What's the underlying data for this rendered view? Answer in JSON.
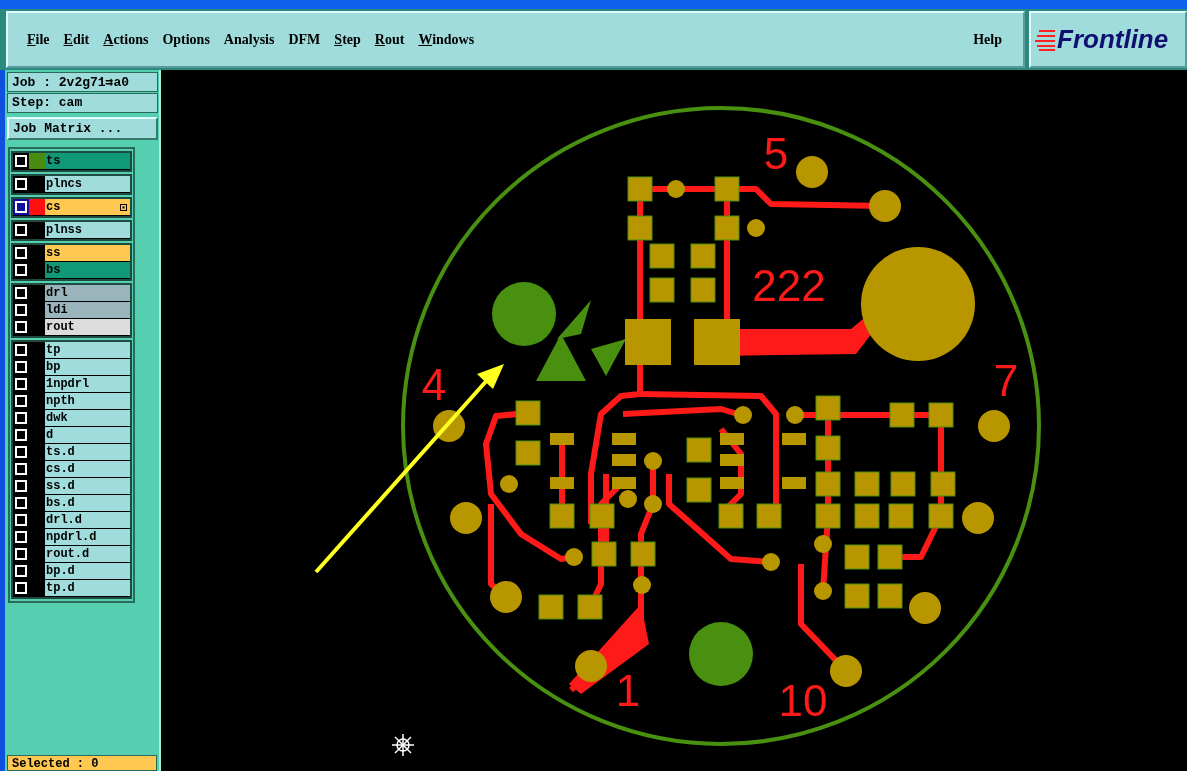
{
  "menu": [
    {
      "label": "File",
      "underlined": true
    },
    {
      "label": "Edit",
      "underlined": true
    },
    {
      "label": "Actions",
      "underlined": true
    },
    {
      "label": "Options",
      "underlined": false
    },
    {
      "label": "Analysis",
      "underlined": false
    },
    {
      "label": "DFM",
      "underlined": false
    },
    {
      "label": "Step",
      "underlined": true
    },
    {
      "label": "Rout",
      "underlined": true
    },
    {
      "label": "Windows",
      "underlined": true
    }
  ],
  "help": "Help",
  "logo": "Frontline",
  "job": "Job : 2v2g71⇉a0",
  "step": "Step: cam",
  "job_matrix_button": "Job Matrix ...",
  "layer_groups": [
    [
      {
        "name": "ts",
        "color": "#119977",
        "swatch": {
          "color": "#4a8c10"
        },
        "active": false
      }
    ],
    [
      {
        "name": "plncs",
        "color": "#a0dcdc",
        "active": false
      }
    ],
    [
      {
        "name": "cs",
        "color": "#ffc850",
        "swatch": {
          "color": "#ff1010"
        },
        "active": true
      }
    ],
    [
      {
        "name": "plnss",
        "color": "#a0dcdc",
        "active": false
      }
    ],
    [
      {
        "name": "ss",
        "color": "#ffc850",
        "active": false
      },
      {
        "name": "bs",
        "color": "#119977",
        "active": false
      }
    ],
    [
      {
        "name": "drl",
        "color": "#9ab4bc",
        "active": false
      },
      {
        "name": "ldi",
        "color": "#9ab4bc",
        "active": false
      },
      {
        "name": "rout",
        "color": "#dcdcdc",
        "active": false
      }
    ],
    [
      {
        "name": "tp",
        "color": "#a0dcdc",
        "active": false
      },
      {
        "name": "bp",
        "color": "#a0dcdc",
        "active": false
      },
      {
        "name": "1npdrl",
        "color": "#a0dcdc",
        "active": false
      },
      {
        "name": "npth",
        "color": "#a0dcdc",
        "active": false
      },
      {
        "name": "dwk",
        "color": "#a0dcdc",
        "active": false
      },
      {
        "name": "d",
        "color": "#a0dcdc",
        "active": false
      },
      {
        "name": "ts.d",
        "color": "#a0dcdc",
        "active": false
      },
      {
        "name": "cs.d",
        "color": "#a0dcdc",
        "active": false
      },
      {
        "name": "ss.d",
        "color": "#a0dcdc",
        "active": false
      },
      {
        "name": "bs.d",
        "color": "#a0dcdc",
        "active": false
      },
      {
        "name": "drl.d",
        "color": "#a0dcdc",
        "active": false
      },
      {
        "name": "npdrl.d",
        "color": "#a0dcdc",
        "active": false
      },
      {
        "name": "rout.d",
        "color": "#a0dcdc",
        "active": false
      },
      {
        "name": "bp.d",
        "color": "#a0dcdc",
        "active": false
      },
      {
        "name": "tp.d",
        "color": "#a0dcdc",
        "active": false
      }
    ]
  ],
  "board_labels": [
    "5",
    "222",
    "4",
    "7",
    "1",
    "10"
  ],
  "status": "Selected : 0"
}
